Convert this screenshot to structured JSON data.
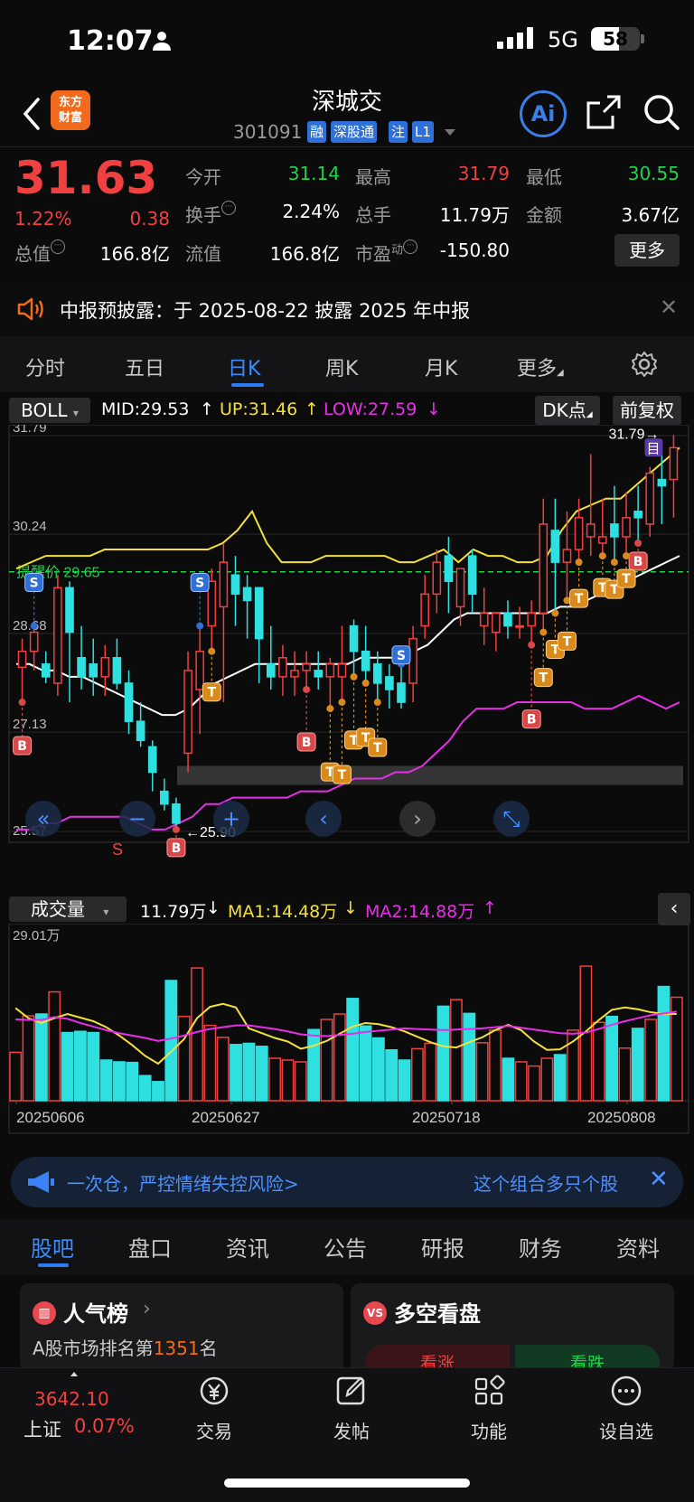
{
  "status_bar": {
    "time": "12:07",
    "network": "5G",
    "battery": "58"
  },
  "header": {
    "stock_name": "深城交",
    "stock_code": "301091",
    "logo_text": "东方财富",
    "tags": [
      "融",
      "深股通",
      "注",
      "L1"
    ],
    "ai_label": "Ai"
  },
  "quote": {
    "price": "31.63",
    "change_pct": "1.22%",
    "change": "0.38",
    "fields": [
      {
        "label": "今开",
        "value": "31.14",
        "color": "#1fd34a"
      },
      {
        "label": "最高",
        "value": "31.79",
        "color": "#f04040"
      },
      {
        "label": "最低",
        "value": "30.55",
        "color": "#1fd34a"
      },
      {
        "label": "换手",
        "value": "2.24%",
        "color": "#ffffff"
      },
      {
        "label": "总手",
        "value": "11.79万",
        "color": "#ffffff"
      },
      {
        "label": "金额",
        "value": "3.67亿",
        "color": "#ffffff"
      },
      {
        "label": "总值",
        "value": "166.8亿",
        "color": "#ffffff"
      },
      {
        "label": "流值",
        "value": "166.8亿",
        "color": "#ffffff"
      },
      {
        "label": "市盈",
        "label_sup": "动",
        "value": "-150.80",
        "color": "#ffffff"
      }
    ],
    "more_button": "更多"
  },
  "notice": {
    "text": "中报预披露：于 2025-08-22 披露 2025 年中报",
    "icon": "speaker-icon"
  },
  "kline_tabs": {
    "items": [
      "分时",
      "五日",
      "日K",
      "周K",
      "月K",
      "更多"
    ],
    "active": "日K"
  },
  "indicator": {
    "name": "BOLL",
    "mid": "MID:29.53",
    "up": "UP:31.46",
    "low": "LOW:27.59",
    "dk_button": "DK点",
    "adjust_button": "前复权"
  },
  "chart_data": [
    {
      "type": "candlestick",
      "title": "",
      "y_tick_labels": [
        "31.79",
        "30.24",
        "28.68",
        "27.13",
        "25.57"
      ],
      "ylim": [
        25.57,
        31.79
      ],
      "alert_line": {
        "label": "提醒价 29.65",
        "value": 29.65
      },
      "annotations": {
        "low_marker": "←25.90",
        "high_marker": "31.79→",
        "marker_char": "目"
      },
      "candles": [
        {
          "o": 28.15,
          "h": 28.6,
          "l": 27.6,
          "c": 28.4
        },
        {
          "o": 28.4,
          "h": 28.8,
          "l": 28.1,
          "c": 28.7
        },
        {
          "o": 28.2,
          "h": 28.4,
          "l": 27.9,
          "c": 28.0
        },
        {
          "o": 27.9,
          "h": 29.6,
          "l": 27.7,
          "c": 29.4
        },
        {
          "o": 29.4,
          "h": 29.5,
          "l": 27.6,
          "c": 28.7
        },
        {
          "o": 28.3,
          "h": 28.8,
          "l": 27.8,
          "c": 28.0
        },
        {
          "o": 28.2,
          "h": 28.6,
          "l": 27.7,
          "c": 28.0
        },
        {
          "o": 28.0,
          "h": 28.5,
          "l": 27.7,
          "c": 28.3
        },
        {
          "o": 28.3,
          "h": 28.6,
          "l": 27.8,
          "c": 27.9
        },
        {
          "o": 27.9,
          "h": 28.1,
          "l": 27.1,
          "c": 27.3
        },
        {
          "o": 27.3,
          "h": 27.6,
          "l": 26.9,
          "c": 27.0
        },
        {
          "o": 26.9,
          "h": 27.0,
          "l": 26.2,
          "c": 26.5
        },
        {
          "o": 26.2,
          "h": 26.4,
          "l": 25.9,
          "c": 26.0
        },
        {
          "o": 26.0,
          "h": 26.1,
          "l": 25.6,
          "c": 25.7
        },
        {
          "o": 26.8,
          "h": 28.4,
          "l": 26.5,
          "c": 28.1
        },
        {
          "o": 27.8,
          "h": 28.8,
          "l": 27.1,
          "c": 28.4
        },
        {
          "o": 28.8,
          "h": 29.7,
          "l": 28.4,
          "c": 29.5
        },
        {
          "o": 29.1,
          "h": 30.1,
          "l": 27.6,
          "c": 29.8
        },
        {
          "o": 29.6,
          "h": 29.9,
          "l": 28.8,
          "c": 29.3
        },
        {
          "o": 29.4,
          "h": 29.6,
          "l": 28.6,
          "c": 29.2
        },
        {
          "o": 29.4,
          "h": 29.4,
          "l": 27.9,
          "c": 28.6
        },
        {
          "o": 28.2,
          "h": 28.8,
          "l": 27.8,
          "c": 28.0
        },
        {
          "o": 28.0,
          "h": 28.5,
          "l": 27.7,
          "c": 28.3
        },
        {
          "o": 28.0,
          "h": 28.4,
          "l": 27.7,
          "c": 28.1
        },
        {
          "o": 28.1,
          "h": 28.4,
          "l": 27.8,
          "c": 28.2
        },
        {
          "o": 28.1,
          "h": 28.4,
          "l": 27.8,
          "c": 28.0
        },
        {
          "o": 28.0,
          "h": 28.3,
          "l": 27.5,
          "c": 28.2
        },
        {
          "o": 28.0,
          "h": 28.8,
          "l": 27.6,
          "c": 28.2
        },
        {
          "o": 28.8,
          "h": 28.9,
          "l": 28.0,
          "c": 28.4
        },
        {
          "o": 28.4,
          "h": 28.8,
          "l": 27.9,
          "c": 28.1
        },
        {
          "o": 28.2,
          "h": 28.4,
          "l": 27.6,
          "c": 27.9
        },
        {
          "o": 28.0,
          "h": 28.2,
          "l": 27.5,
          "c": 27.8
        },
        {
          "o": 27.9,
          "h": 28.2,
          "l": 27.5,
          "c": 27.6
        },
        {
          "o": 27.9,
          "h": 28.8,
          "l": 27.6,
          "c": 28.6
        },
        {
          "o": 28.8,
          "h": 29.6,
          "l": 28.6,
          "c": 29.3
        },
        {
          "o": 29.3,
          "h": 30.0,
          "l": 29.0,
          "c": 29.8
        },
        {
          "o": 29.9,
          "h": 30.2,
          "l": 29.0,
          "c": 29.5
        },
        {
          "o": 29.1,
          "h": 29.7,
          "l": 28.8,
          "c": 29.7
        },
        {
          "o": 29.9,
          "h": 30.0,
          "l": 29.0,
          "c": 29.3
        },
        {
          "o": 28.8,
          "h": 29.4,
          "l": 28.5,
          "c": 29.0
        },
        {
          "o": 28.7,
          "h": 29.0,
          "l": 28.4,
          "c": 29.0
        },
        {
          "o": 29.0,
          "h": 29.2,
          "l": 28.6,
          "c": 28.8
        },
        {
          "o": 28.8,
          "h": 29.1,
          "l": 28.6,
          "c": 28.8
        },
        {
          "o": 28.8,
          "h": 29.2,
          "l": 28.5,
          "c": 29.0
        },
        {
          "o": 29.0,
          "h": 30.8,
          "l": 28.7,
          "c": 30.4
        },
        {
          "o": 30.3,
          "h": 30.8,
          "l": 29.0,
          "c": 29.8
        },
        {
          "o": 29.8,
          "h": 30.6,
          "l": 29.2,
          "c": 30.0
        },
        {
          "o": 30.0,
          "h": 30.8,
          "l": 29.8,
          "c": 30.5
        },
        {
          "o": 30.2,
          "h": 31.5,
          "l": 29.9,
          "c": 30.4
        },
        {
          "o": 30.1,
          "h": 30.8,
          "l": 29.9,
          "c": 30.2
        },
        {
          "o": 30.4,
          "h": 31.0,
          "l": 29.8,
          "c": 30.2
        },
        {
          "o": 30.2,
          "h": 30.9,
          "l": 29.9,
          "c": 30.5
        },
        {
          "o": 30.6,
          "h": 31.0,
          "l": 30.1,
          "c": 30.5
        },
        {
          "o": 30.4,
          "h": 31.3,
          "l": 30.2,
          "c": 31.2
        },
        {
          "o": 31.1,
          "h": 31.6,
          "l": 30.4,
          "c": 31.0
        },
        {
          "o": 31.1,
          "h": 31.8,
          "l": 30.5,
          "c": 31.6
        }
      ],
      "boll_mid": [
        28.2,
        28.2,
        28.1,
        28.1,
        28.0,
        28.0,
        27.9,
        27.8,
        27.7,
        27.6,
        27.5,
        27.4,
        27.4,
        27.5,
        27.7,
        27.9,
        28.0,
        28.1,
        28.2,
        28.2,
        28.2,
        28.2,
        28.2,
        28.2,
        28.2,
        28.2,
        28.3,
        28.3,
        28.3,
        28.3,
        28.4,
        28.5,
        28.7,
        28.9,
        29.0,
        29.0,
        29.0,
        29.0,
        29.0,
        29.0,
        29.0,
        29.1,
        29.1,
        29.2,
        29.3,
        29.4,
        29.5,
        29.6,
        29.7,
        29.8,
        29.9
      ],
      "boll_up": [
        29.7,
        29.8,
        29.9,
        29.9,
        29.9,
        29.9,
        30.0,
        30.0,
        30.0,
        30.0,
        30.0,
        30.0,
        30.0,
        30.0,
        30.1,
        30.3,
        30.6,
        30.1,
        29.8,
        29.8,
        29.8,
        29.9,
        29.9,
        29.9,
        29.9,
        29.9,
        29.8,
        29.8,
        29.9,
        30.0,
        29.8,
        30.0,
        29.9,
        29.9,
        29.8,
        29.8,
        29.9,
        30.3,
        30.6,
        30.7,
        30.8,
        30.8,
        31.0,
        31.2,
        31.4,
        31.6
      ],
      "boll_low": [
        25.6,
        25.6,
        25.7,
        25.7,
        25.8,
        25.8,
        25.8,
        25.8,
        25.8,
        25.7,
        25.6,
        25.6,
        25.7,
        25.8,
        26.0,
        26.0,
        26.1,
        26.1,
        26.1,
        26.1,
        26.1,
        26.2,
        26.2,
        26.2,
        26.3,
        26.4,
        26.4,
        26.4,
        26.5,
        26.5,
        26.6,
        26.8,
        27.0,
        27.3,
        27.5,
        27.5,
        27.5,
        27.6,
        27.6,
        27.6,
        27.6,
        27.6,
        27.5,
        27.5,
        27.5,
        27.6,
        27.7,
        27.6,
        27.5,
        27.6
      ],
      "signals": [
        "B",
        "S",
        "T"
      ]
    },
    {
      "type": "bar",
      "title": "成交量",
      "current": "11.79万",
      "ma1": "MA1:14.48万",
      "ma2": "MA2:14.88万",
      "y_top_label": "29.01万",
      "x_tick_labels": [
        "20250606",
        "20250627",
        "20250718",
        "20250808"
      ],
      "values": [
        8.1,
        14.2,
        14.5,
        18.2,
        11.4,
        11.6,
        11.4,
        6.8,
        6.5,
        6.4,
        4.2,
        3.2,
        20.1,
        14.1,
        22.2,
        12.6,
        10.6,
        9.4,
        9.6,
        9.1,
        7.1,
        6.8,
        6.5,
        11.9,
        13.6,
        14.5,
        17.1,
        12.5,
        10.5,
        8.5,
        6.8,
        8.7,
        9.6,
        15.8,
        16.9,
        14.6,
        9.7,
        11.8,
        7.1,
        6.5,
        5.8,
        7.1,
        7.7,
        11.8,
        22.5,
        13.1,
        14.1,
        8.8,
        12.1,
        13.6,
        19.1,
        17.3
      ],
      "ma1_values": [
        15.5,
        13.8,
        13.0,
        13.8,
        14.5,
        13.9,
        13.3,
        12.3,
        10.9,
        9.3,
        7.5,
        6.2,
        8.2,
        10.3,
        13.8,
        15.7,
        16.2,
        15.6,
        12.1,
        11.3,
        10.5,
        9.9,
        8.7,
        9.2,
        10.0,
        11.2,
        12.4,
        13.0,
        12.8,
        12.3,
        11.6,
        10.7,
        9.8,
        9.1,
        8.9,
        9.8,
        10.6,
        11.8,
        12.7,
        11.8,
        9.9,
        8.5,
        8.6,
        9.9,
        11.6,
        13.5,
        15.2,
        15.6,
        15.3,
        14.8,
        14.5,
        14.5
      ],
      "ma2_values": [
        13.6,
        13.5,
        13.5,
        14.0,
        13.7,
        13.0,
        12.4,
        11.8,
        11.3,
        10.9,
        10.5,
        10.0,
        10.4,
        10.9,
        11.5,
        12.0,
        12.3,
        12.6,
        12.6,
        12.3,
        12.0,
        11.6,
        11.1,
        10.9,
        10.8,
        11.0,
        11.2,
        11.5,
        11.7,
        11.9,
        12.1,
        12.0,
        11.9,
        11.8,
        11.9,
        12.0,
        12.1,
        12.3,
        12.5,
        12.2,
        11.9,
        11.6,
        11.3,
        11.2,
        11.4,
        12.0,
        12.7,
        13.3,
        13.8,
        14.3,
        14.6,
        14.9
      ],
      "ylim": [
        0,
        29.01
      ]
    }
  ],
  "ticker": {
    "left_text": "一次仓，严控情绪失控风险>",
    "right_text": "这个组合多只个股"
  },
  "bottom_tabs": {
    "items": [
      "股吧",
      "盘口",
      "资讯",
      "公告",
      "研报",
      "财务",
      "资料"
    ],
    "active": "股吧"
  },
  "cards": {
    "popularity": {
      "title": "人气榜",
      "desc_prefix": "A股市场排名第",
      "rank": "1351",
      "desc_suffix": "名"
    },
    "bull_bear": {
      "title": "多空看盘",
      "bull": "看涨",
      "bear": "看跌"
    }
  },
  "bottom_nav": {
    "index_value": "3642.10",
    "index_name": "上证",
    "index_change": "0.07%",
    "items": [
      {
        "label": "交易",
        "icon": "yuan-exchange-icon"
      },
      {
        "label": "发帖",
        "icon": "edit-icon"
      },
      {
        "label": "功能",
        "icon": "grid-icon"
      },
      {
        "label": "设自选",
        "icon": "more-circle-icon"
      }
    ]
  }
}
